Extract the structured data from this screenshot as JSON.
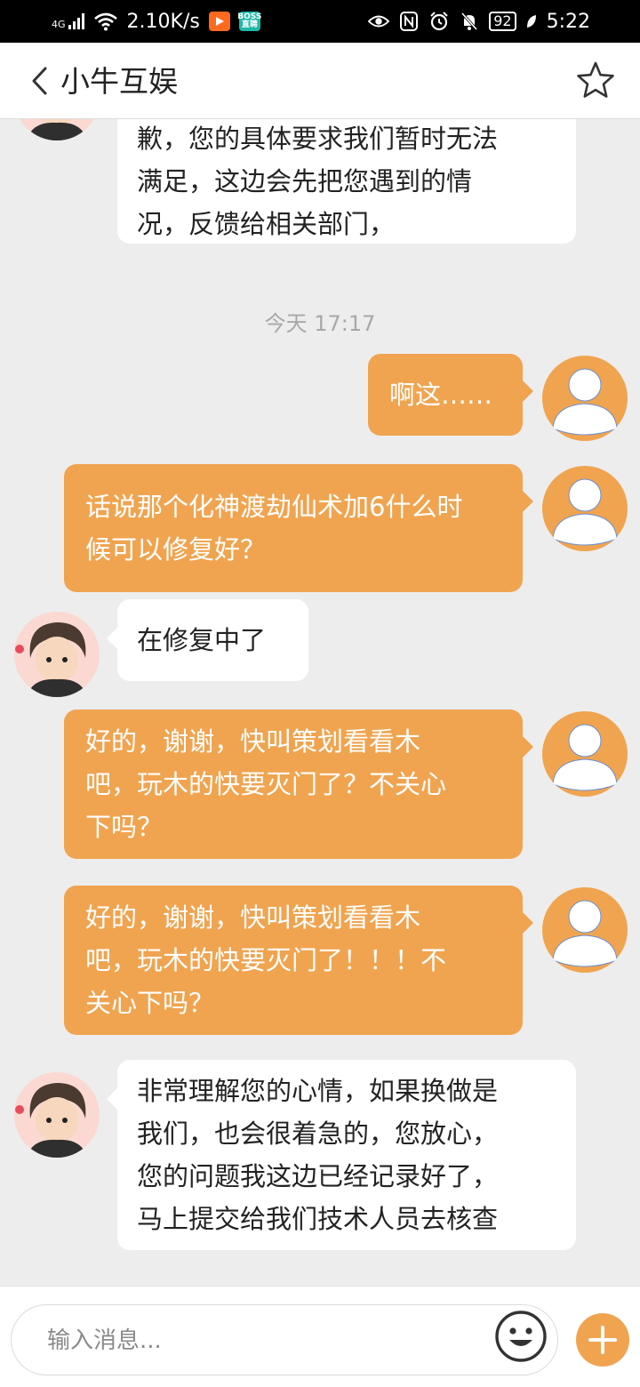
{
  "status_bar": {
    "network": "4G",
    "speed": "2.10K/s",
    "battery": "92",
    "time": "5:22",
    "boss_app_label": "BOSS\n直聘"
  },
  "header": {
    "title": "小牛互娱"
  },
  "chat": {
    "timestamp": "今天 17:17",
    "messages": [
      {
        "side": "in",
        "lines": [
          "歉，您的具体要求我们暂时无法",
          "满足，这边会先把您遇到的情",
          "况，反馈给相关部门，"
        ]
      },
      {
        "side": "out",
        "lines": [
          "啊这……"
        ]
      },
      {
        "side": "out",
        "lines": [
          "话说那个化神渡劫仙术加6什么时",
          "候可以修复好？"
        ]
      },
      {
        "side": "in",
        "lines": [
          "在修复中了"
        ]
      },
      {
        "side": "out",
        "lines": [
          "好的，谢谢，快叫策划看看木",
          "吧，玩木的快要灭门了？不关心",
          "下吗？"
        ]
      },
      {
        "side": "out",
        "lines": [
          "好的，谢谢，快叫策划看看木",
          "吧，玩木的快要灭门了！！！不",
          "关心下吗？"
        ]
      },
      {
        "side": "in",
        "lines": [
          "非常理解您的心情，如果换做是",
          "我们，也会很着急的，您放心，",
          "您的问题我这边已经记录好了，",
          "马上提交给我们技术人员去核查"
        ]
      }
    ]
  },
  "input": {
    "placeholder": "输入消息..."
  },
  "colors": {
    "accent": "#f0a450",
    "background": "#ededed",
    "incoming_bubble": "#ffffff"
  },
  "icons": {
    "back": "chevron-left-icon",
    "favorite": "star-icon",
    "emoji": "smiley-icon",
    "more": "plus-icon"
  }
}
